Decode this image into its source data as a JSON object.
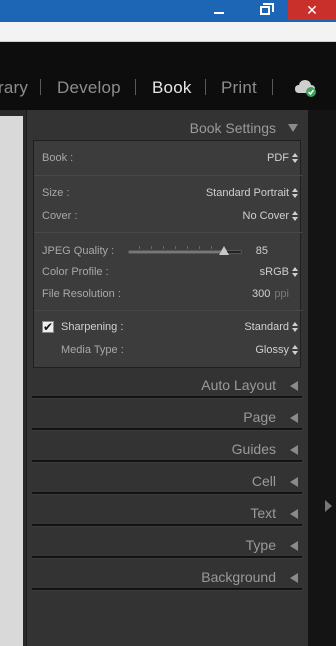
{
  "window": {
    "minimize_glyph": "",
    "restore_glyph": "",
    "close_glyph": "✕"
  },
  "modules": [
    {
      "label": "rary",
      "active": false
    },
    {
      "label": "Develop",
      "active": false
    },
    {
      "label": "Book",
      "active": true
    },
    {
      "label": "Print",
      "active": false
    }
  ],
  "book_settings": {
    "title": "Book Settings",
    "book": {
      "label": "Book :",
      "value": "PDF"
    },
    "size": {
      "label": "Size :",
      "value": "Standard Portrait"
    },
    "cover": {
      "label": "Cover :",
      "value": "No Cover"
    },
    "jpeg_quality": {
      "label": "JPEG Quality :",
      "value": "85",
      "fraction": 0.85
    },
    "color_profile": {
      "label": "Color Profile :",
      "value": "sRGB"
    },
    "file_resolution": {
      "label": "File Resolution :",
      "value": "300",
      "unit": "ppi"
    },
    "sharpening": {
      "label": "Sharpening :",
      "value": "Standard",
      "checked": true,
      "check_glyph": "✔"
    },
    "media_type": {
      "label": "Media Type :",
      "value": "Glossy"
    }
  },
  "sections": [
    "Auto Layout",
    "Page",
    "Guides",
    "Cell",
    "Text",
    "Type",
    "Background"
  ],
  "colors": {
    "titlebar": "#1c66b5",
    "close_button": "#c9302c",
    "cloud_badge": "#3aa55a"
  }
}
